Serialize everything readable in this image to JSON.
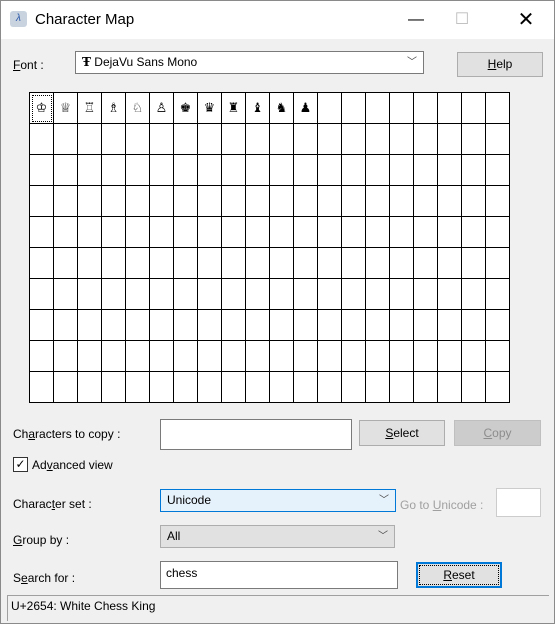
{
  "window": {
    "title": "Character Map",
    "minimize_icon": "minimize-icon",
    "maximize_icon": "maximize-icon",
    "close_icon": "close-icon"
  },
  "font": {
    "label_pre": "",
    "label_key": "F",
    "label_post": "ont :",
    "value": "DejaVu Sans Mono",
    "font_icon": "truetype-icon"
  },
  "help": {
    "pre": "",
    "key": "H",
    "post": "elp"
  },
  "grid": {
    "characters": [
      "♔",
      "♕",
      "♖",
      "♗",
      "♘",
      "♙",
      "♚",
      "♛",
      "♜",
      "♝",
      "♞",
      "♟"
    ],
    "selected_index": 0
  },
  "copy": {
    "label_pre": "Ch",
    "label_key": "a",
    "label_post": "racters to copy :",
    "value": "",
    "select_pre": "",
    "select_key": "S",
    "select_post": "elect",
    "copy_pre": "",
    "copy_key": "C",
    "copy_post": "opy"
  },
  "advanced": {
    "pre": "Ad",
    "key": "v",
    "post": "anced view",
    "checked": true
  },
  "charset": {
    "label_pre": "Charac",
    "label_key": "t",
    "label_post": "er set :",
    "value": "Unicode",
    "goto_pre": "Go to ",
    "goto_key": "U",
    "goto_post": "nicode :",
    "goto_value": ""
  },
  "groupby": {
    "label_pre": "",
    "label_key": "G",
    "label_post": "roup by :",
    "value": "All"
  },
  "search": {
    "label_pre": "S",
    "label_key": "e",
    "label_post": "arch for :",
    "value": "chess",
    "reset_pre": "",
    "reset_key": "R",
    "reset_post": "eset"
  },
  "status": "U+2654: White Chess King"
}
